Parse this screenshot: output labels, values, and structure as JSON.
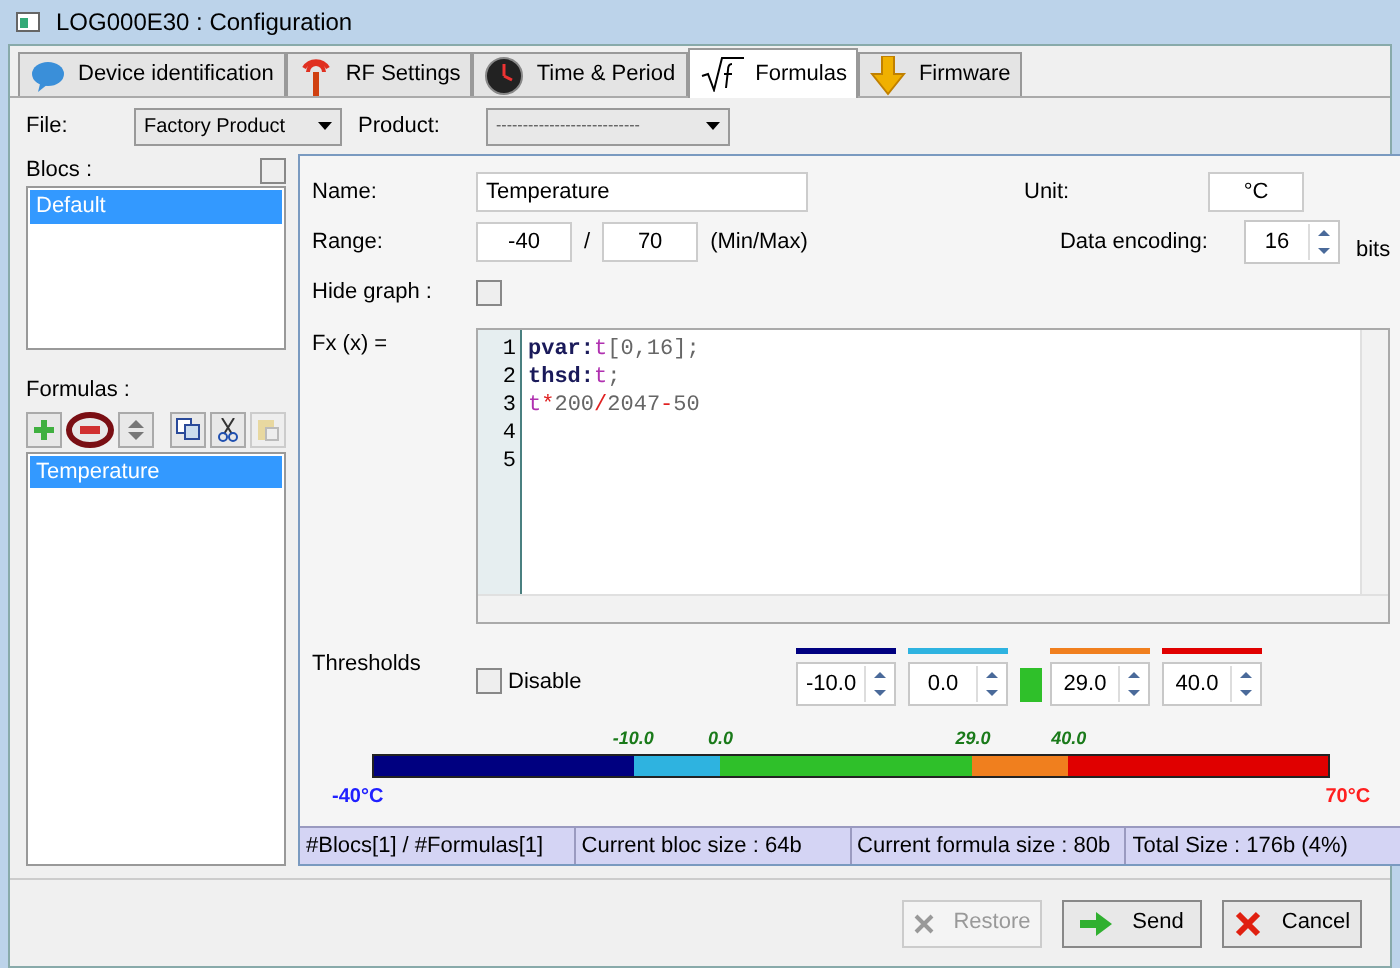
{
  "window": {
    "title": "LOG000E30 : Configuration"
  },
  "tabs": [
    {
      "label": "Device identification",
      "selected": false
    },
    {
      "label": "RF Settings",
      "selected": false
    },
    {
      "label": "Time & Period",
      "selected": false
    },
    {
      "label": "Formulas",
      "selected": true
    },
    {
      "label": "Firmware",
      "selected": false
    }
  ],
  "file": {
    "label": "File:",
    "value": "Factory Product"
  },
  "product": {
    "label": "Product:",
    "value": "---------------------------"
  },
  "blocs": {
    "label": "Blocs :",
    "checked": false,
    "items": [
      {
        "label": "Default",
        "selected": true
      }
    ]
  },
  "formulas": {
    "label": "Formulas :",
    "items": [
      {
        "label": "Temperature",
        "selected": true
      }
    ]
  },
  "form": {
    "name_label": "Name:",
    "name": "Temperature",
    "unit_label": "Unit:",
    "unit": "°C",
    "range_label": "Range:",
    "min": "-40",
    "separator": "/",
    "max": "70",
    "range_hint": "(Min/Max)",
    "encoding_label": "Data encoding:",
    "encoding": "16",
    "encoding_unit": "bits",
    "hide_graph_label": "Hide graph :",
    "hide_graph": false,
    "fx_label": "Fx (x) ="
  },
  "code": [
    [
      {
        "text": "pvar:",
        "kind": "keyword"
      },
      {
        "text": "t",
        "kind": "var"
      },
      {
        "text": "[0,16];",
        "kind": "plain"
      }
    ],
    [
      {
        "text": "thsd:",
        "kind": "keyword"
      },
      {
        "text": "t",
        "kind": "var"
      },
      {
        "text": ";",
        "kind": "plain"
      }
    ],
    [
      {
        "text": "t",
        "kind": "var"
      },
      {
        "text": "*",
        "kind": "op"
      },
      {
        "text": "200",
        "kind": "plain"
      },
      {
        "text": "/",
        "kind": "op"
      },
      {
        "text": "2047",
        "kind": "plain"
      },
      {
        "text": "-",
        "kind": "op"
      },
      {
        "text": "50",
        "kind": "plain"
      }
    ]
  ],
  "line_numbers": [
    "1",
    "2",
    "3",
    "4",
    "5"
  ],
  "thresholds": {
    "label": "Thresholds",
    "disable_label": "Disable",
    "disabled": false,
    "items": [
      {
        "kind": "spin",
        "value": "-10.0",
        "color": "#000080"
      },
      {
        "kind": "spin",
        "value": "0.0",
        "color": "#2eb3e0"
      },
      {
        "kind": "swatch",
        "color": "#2fc02a"
      },
      {
        "kind": "spin",
        "value": "29.0",
        "color": "#f07f1e"
      },
      {
        "kind": "spin",
        "value": "40.0",
        "color": "#e00000"
      }
    ],
    "marks": [
      "-10.0",
      "0.0",
      "29.0",
      "40.0"
    ],
    "min_label": "-40°C",
    "max_label": "70°C"
  },
  "status_bar": [
    "#Blocs[1] / #Formulas[1]",
    "Current bloc size : 64b",
    "Current formula size : 80b",
    "Total Size : 176b (4%)"
  ],
  "buttons": [
    {
      "label": "Restore",
      "disabled": true
    },
    {
      "label": "Send",
      "disabled": false
    },
    {
      "label": "Cancel",
      "disabled": false
    }
  ]
}
